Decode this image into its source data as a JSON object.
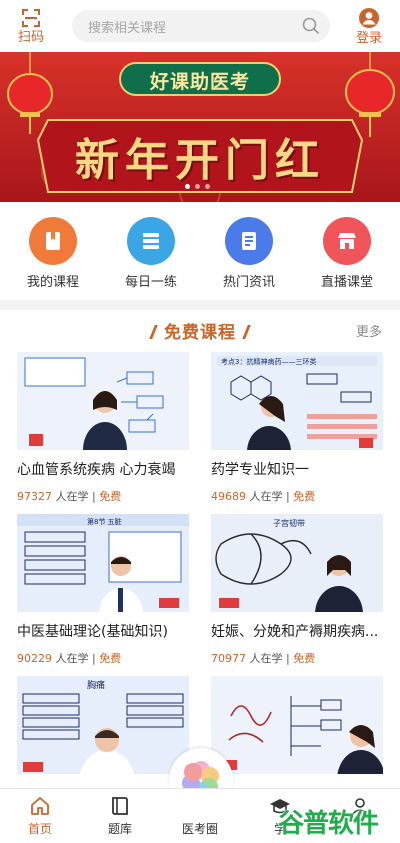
{
  "header": {
    "scan_label": "扫码",
    "search_placeholder": "搜索相关课程",
    "login_label": "登录"
  },
  "banner": {
    "badge_text": "好课助医考",
    "headline": "新年开门红",
    "slides": 3,
    "active_slide": 0
  },
  "quick_nav": [
    {
      "label": "我的课程",
      "icon": "bookmark-book-icon",
      "color": "#f07a3a"
    },
    {
      "label": "每日一练",
      "icon": "books-stack-icon",
      "color": "#3aa6e6"
    },
    {
      "label": "热门资讯",
      "icon": "news-document-icon",
      "color": "#4a7be8"
    },
    {
      "label": "直播课堂",
      "icon": "storefront-icon",
      "color": "#f0555a"
    }
  ],
  "section": {
    "title": "免费课程",
    "more_label": "更多"
  },
  "courses": [
    {
      "title": "心血管系统疾病 心力衰竭",
      "learners": "97327",
      "learners_suffix": "人在学",
      "price": "免费",
      "thumb_text": "考点3：抗精神病药——三环类"
    },
    {
      "title": "药学专业知识一",
      "learners": "49689",
      "learners_suffix": "人在学",
      "price": "免费",
      "thumb_text": "考点3：抗精神病药——三环类"
    },
    {
      "title": "中医基础理论(基础知识)",
      "learners": "90229",
      "learners_suffix": "人在学",
      "price": "免费",
      "thumb_text": "第8节 五脏"
    },
    {
      "title": "妊娠、分娩和产褥期疾病...",
      "learners": "70977",
      "learners_suffix": "人在学",
      "price": "免费",
      "thumb_text": "子宫韧带"
    },
    {
      "title": "",
      "learners": "",
      "learners_suffix": "",
      "price": "",
      "thumb_text": "胸痛"
    },
    {
      "title": "",
      "learners": "",
      "learners_suffix": "",
      "price": "",
      "thumb_text": ""
    }
  ],
  "tabs": [
    {
      "label": "首页",
      "icon": "home-icon",
      "active": true
    },
    {
      "label": "题库",
      "icon": "book-icon",
      "active": false
    },
    {
      "label": "医考圈",
      "icon": "circle-logo-icon",
      "active": false
    },
    {
      "label": "学",
      "icon": "graduation-cap-icon",
      "active": false
    },
    {
      "label": "",
      "icon": "user-icon",
      "active": false
    }
  ],
  "watermark": "谷普软件园",
  "colors": {
    "accent": "#c9652b",
    "banner_red": "#c7241f",
    "gold": "#f6d37a"
  }
}
